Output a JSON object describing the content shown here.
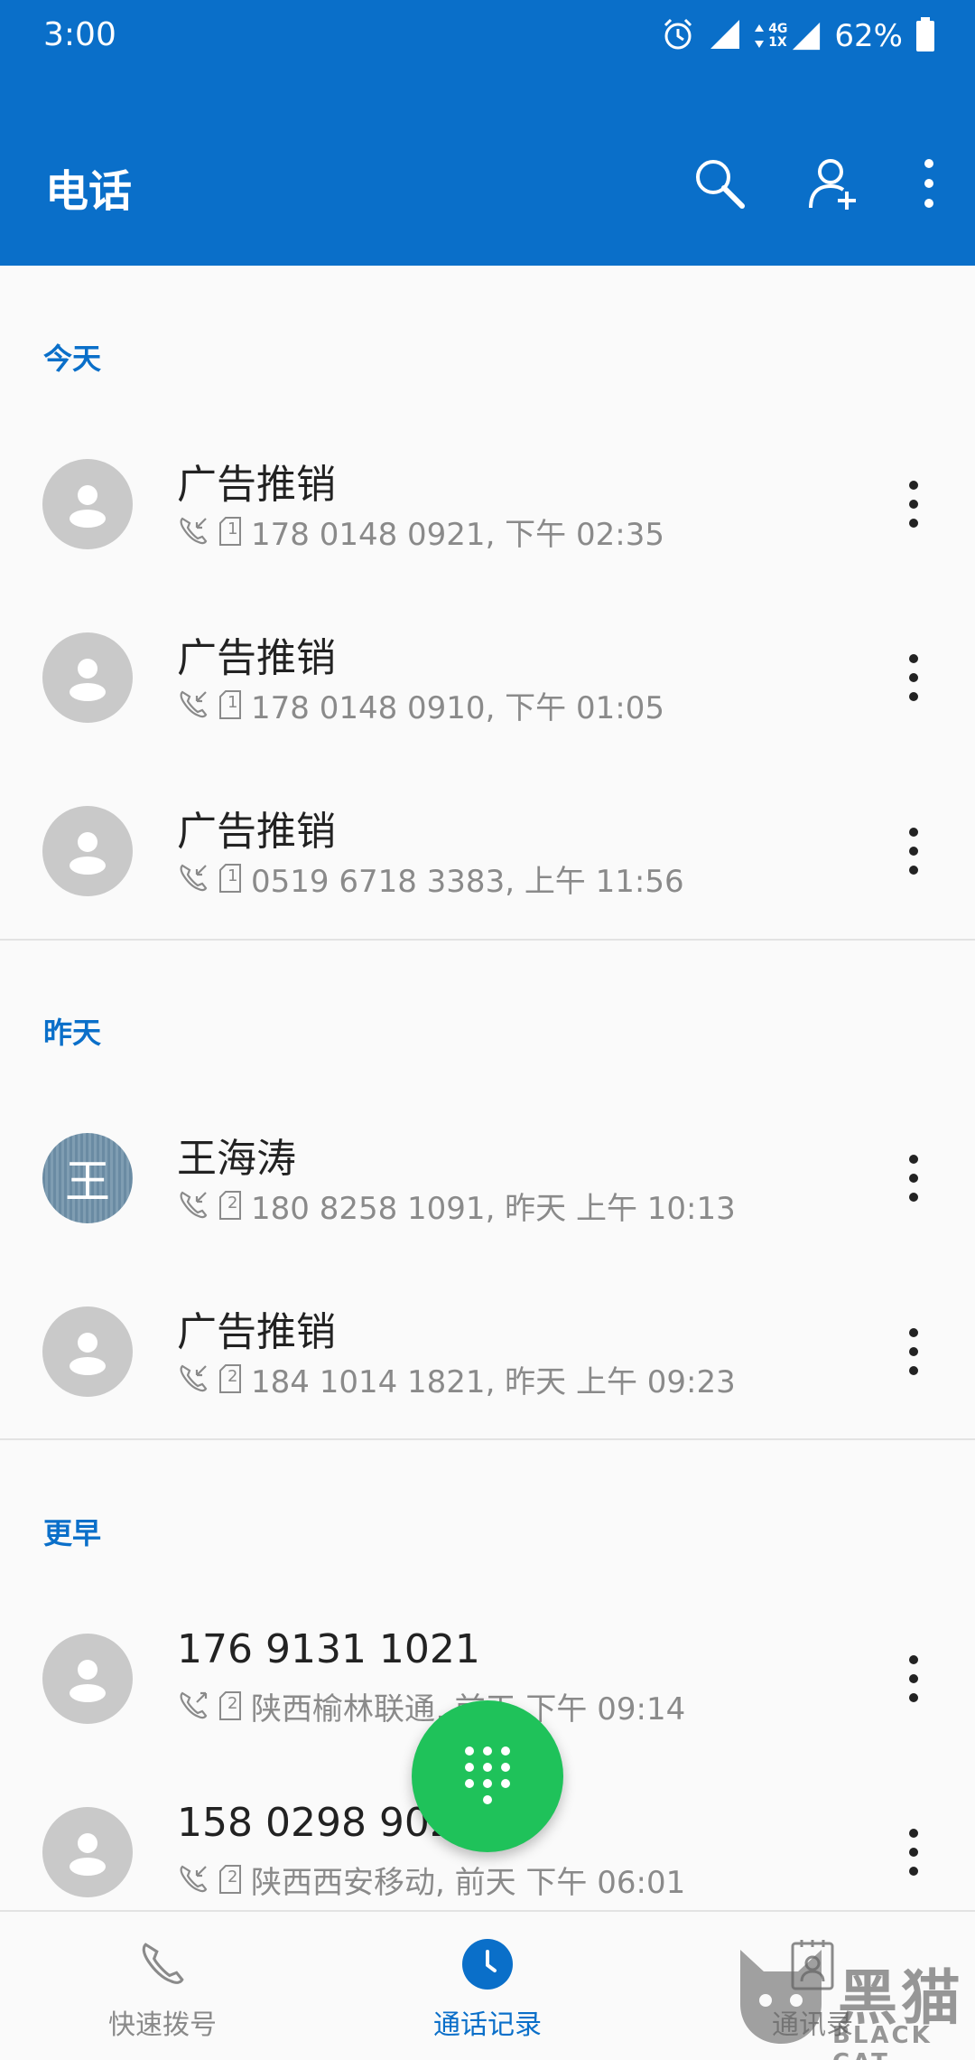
{
  "status_bar": {
    "time": "3:00",
    "network": "4G",
    "network_sub": "1X",
    "battery": "62%",
    "icons": [
      "alarm-icon",
      "signal-icon",
      "data-icon",
      "battery-icon"
    ]
  },
  "app_bar": {
    "title": "电话",
    "actions": [
      "search-icon",
      "add-contact-icon",
      "more-icon"
    ]
  },
  "sections": [
    {
      "label": "今天",
      "calls": [
        {
          "name": "广告推销",
          "sim": "1",
          "detail": "178 0148 0921, 下午 02:35",
          "direction": "incoming"
        },
        {
          "name": "广告推销",
          "sim": "1",
          "detail": "178 0148 0910, 下午 01:05",
          "direction": "incoming"
        },
        {
          "name": "广告推销",
          "sim": "1",
          "detail": "0519 6718 3383, 上午 11:56",
          "direction": "incoming"
        }
      ]
    },
    {
      "label": "昨天",
      "calls": [
        {
          "name": "王海涛",
          "avatar_letter": "王",
          "sim": "2",
          "detail": "180 8258 1091, 昨天 上午 10:13",
          "direction": "incoming"
        },
        {
          "name": "广告推销",
          "sim": "2",
          "detail": "184 1014 1821, 昨天 上午 09:23",
          "direction": "incoming"
        }
      ]
    },
    {
      "label": "更早",
      "calls": [
        {
          "name": "176 9131 1021",
          "sim": "2",
          "detail": "陕西榆林联通, 前天 下午 09:14",
          "direction": "outgoing"
        },
        {
          "name": "158 0298 9021",
          "sim": "2",
          "detail": "陕西西安移动, 前天 下午 06:01",
          "direction": "incoming"
        }
      ]
    }
  ],
  "fab": {
    "icon": "dialpad-icon"
  },
  "bottom_nav": [
    {
      "label": "快速拨号",
      "icon": "phone-icon",
      "active": false
    },
    {
      "label": "通话记录",
      "icon": "clock-icon",
      "active": true
    },
    {
      "label": "通讯录",
      "icon": "contacts-icon",
      "active": false
    }
  ],
  "watermark": {
    "text": "黑猫",
    "sub": "BLACK CAT"
  },
  "colors": {
    "primary": "#0a6fc9",
    "fab": "#1fc25a",
    "avatar_bg": "#c9c9c9"
  }
}
